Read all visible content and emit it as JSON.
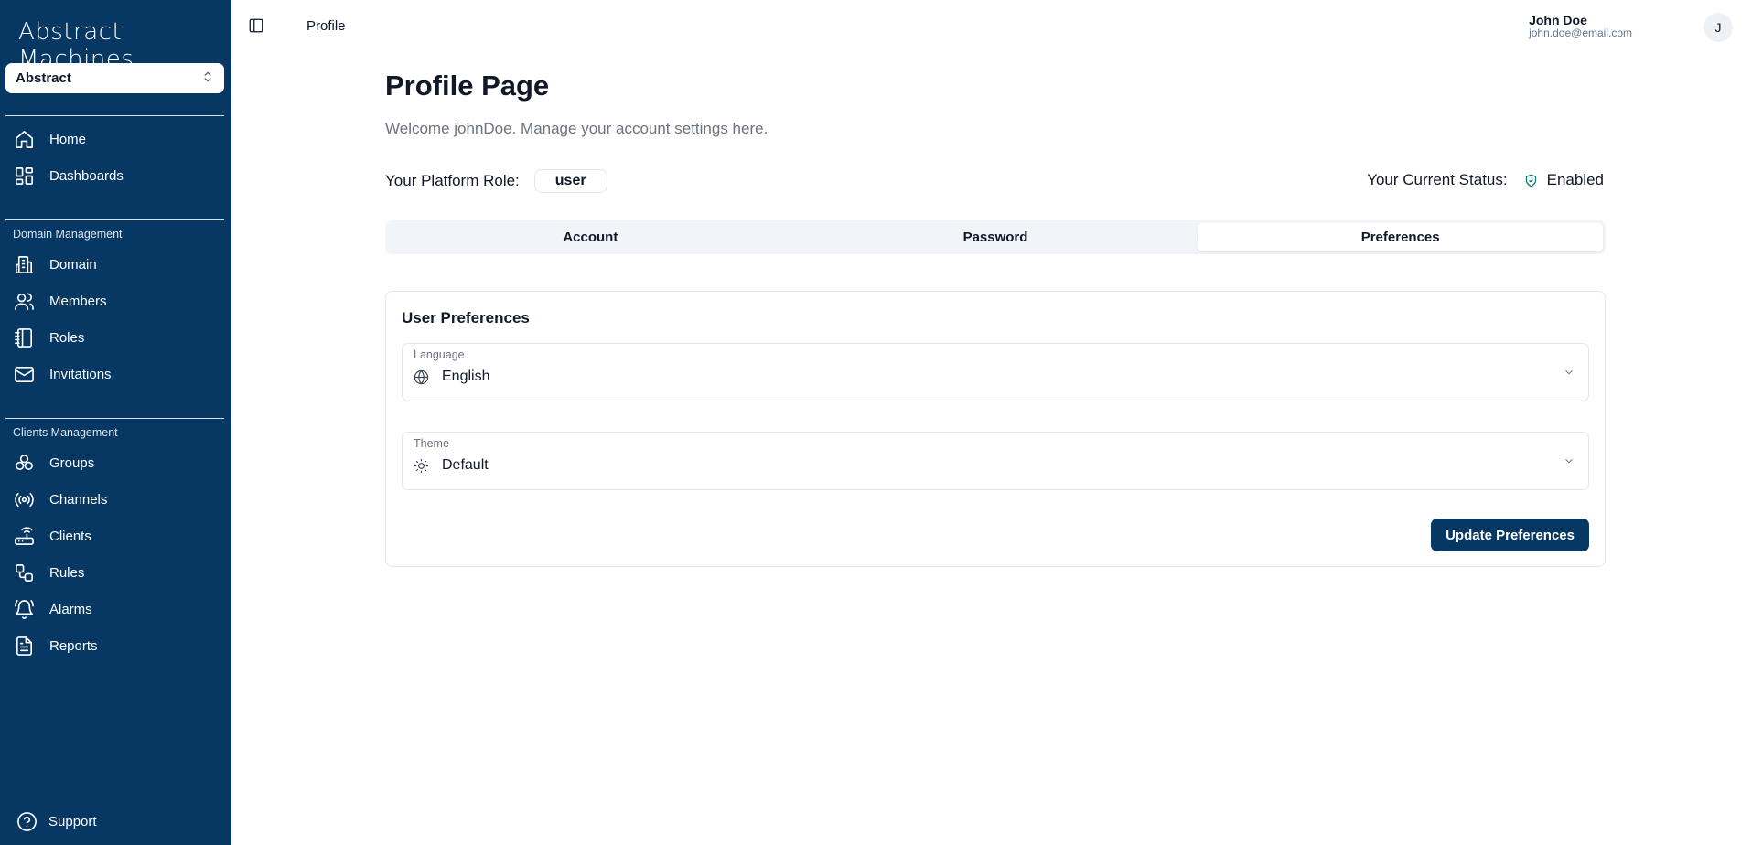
{
  "app": {
    "logo_text": "Abstract Machines",
    "workspace": "Abstract"
  },
  "sidebar": {
    "top_items": [
      {
        "label": "Home",
        "icon": "home-icon"
      },
      {
        "label": "Dashboards",
        "icon": "dashboard-icon"
      }
    ],
    "domain_section": {
      "label": "Domain Management",
      "items": [
        {
          "label": "Domain",
          "icon": "building-icon"
        },
        {
          "label": "Members",
          "icon": "users-icon"
        },
        {
          "label": "Roles",
          "icon": "notebook-icon"
        },
        {
          "label": "Invitations",
          "icon": "mail-icon"
        }
      ]
    },
    "clients_section": {
      "label": "Clients Management",
      "items": [
        {
          "label": "Groups",
          "icon": "groups-icon"
        },
        {
          "label": "Channels",
          "icon": "radio-icon"
        },
        {
          "label": "Clients",
          "icon": "router-icon"
        },
        {
          "label": "Rules",
          "icon": "workflow-icon"
        },
        {
          "label": "Alarms",
          "icon": "bell-icon"
        },
        {
          "label": "Reports",
          "icon": "file-icon"
        }
      ]
    },
    "support_label": "Support"
  },
  "header": {
    "breadcrumb": "Profile",
    "user_name": "John Doe",
    "user_email": "john.doe@email.com",
    "avatar_initial": "J"
  },
  "main": {
    "title": "Profile Page",
    "subtitle": "Welcome johnDoe. Manage your account settings here.",
    "role_label": "Your Platform Role:",
    "role_value": "user",
    "status_label": "Your Current Status:",
    "status_value": "Enabled",
    "tabs": [
      {
        "label": "Account",
        "active": false
      },
      {
        "label": "Password",
        "active": false
      },
      {
        "label": "Preferences",
        "active": true
      }
    ],
    "preferences": {
      "title": "User Preferences",
      "language_label": "Language",
      "language_value": "English",
      "theme_label": "Theme",
      "theme_value": "Default",
      "update_button": "Update Preferences"
    }
  },
  "colors": {
    "sidebar_bg": "#073763",
    "accent": "#073763",
    "status_icon": "#0f766e"
  }
}
